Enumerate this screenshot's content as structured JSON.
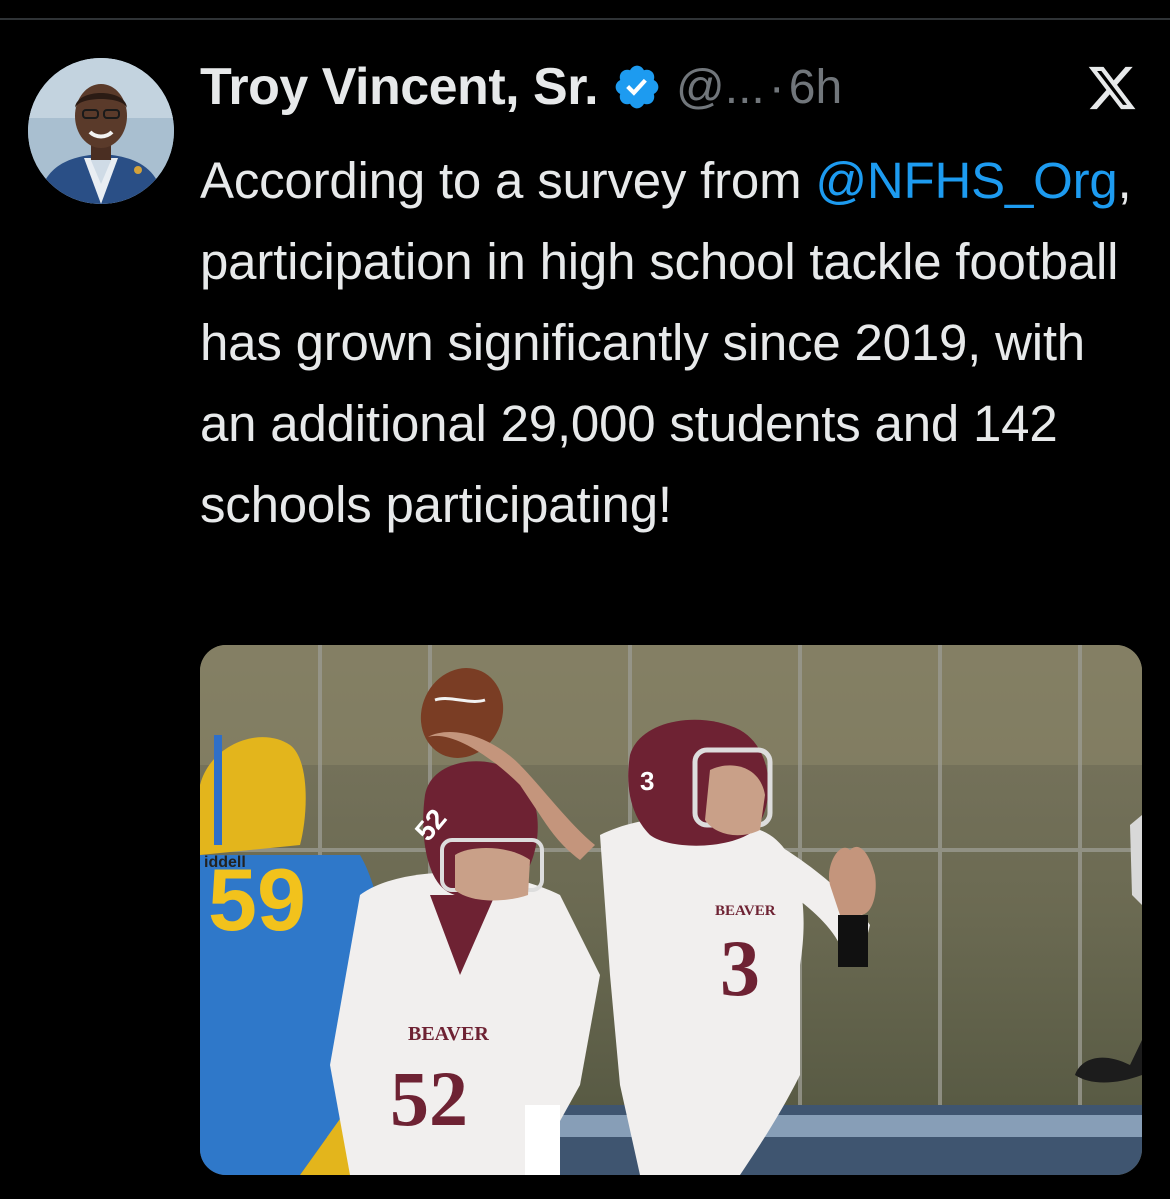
{
  "tweet": {
    "author": {
      "display_name": "Troy Vincent, Sr.",
      "handle": "@...",
      "verified": true
    },
    "separator": "·",
    "timestamp": "6h",
    "text": {
      "part1": "According to a survey from ",
      "mention": "@NFHS_Org",
      "part2": ", participation in high school tackle football has grown significantly since 2019, with an additional 29,000 students and 142 schools participating!"
    },
    "media": {
      "jersey_text_1": "BEAVER",
      "jersey_number_1": "52",
      "jersey_number_helmet_1": "52",
      "jersey_text_2": "BEAVER",
      "jersey_number_2": "3",
      "jersey_number_helmet_2": "3",
      "jersey_number_3": "59",
      "brand_text": "iddell"
    }
  },
  "icons": {
    "verified": "verified-badge-icon",
    "close": "x-logo-icon"
  },
  "colors": {
    "background": "#000000",
    "text": "#e7e9ea",
    "secondary": "#71767b",
    "link": "#1d9bf0",
    "maroon": "#6e2233"
  }
}
